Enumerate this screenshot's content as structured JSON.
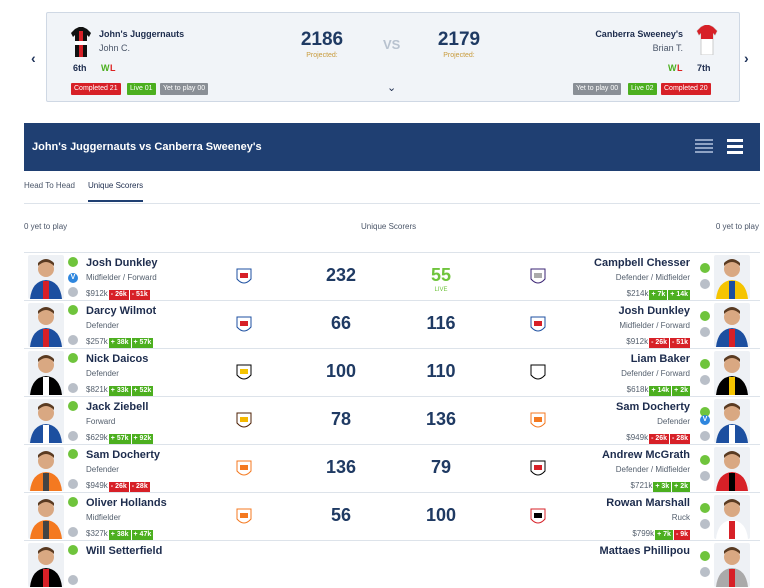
{
  "matchup": {
    "left": {
      "team": "John's Juggernauts",
      "coach": "John C.",
      "rank": "6th",
      "w": "W",
      "l": "L",
      "score": "2186",
      "projected": "Projected:",
      "completed": "Completed 21",
      "live": "Live 01",
      "ytp": "Yet to play 00"
    },
    "right": {
      "team": "Canberra Sweeney's",
      "coach": "Brian T.",
      "rank": "7th",
      "w": "W",
      "l": "L",
      "score": "2179",
      "projected": "Projected:",
      "completed": "Completed 20",
      "live": "Live 02",
      "ytp": "Yet to play 00"
    },
    "vs": "VS"
  },
  "banner": {
    "title": "John's Juggernauts vs Canberra Sweeney's"
  },
  "tabs": [
    "Head To Head",
    "Unique Scorers"
  ],
  "subheader": {
    "left": "0 yet to play",
    "center": "Unique Scorers",
    "right": "0 yet to play"
  },
  "rows": [
    {
      "l": {
        "name": "Josh Dunkley",
        "pos": "Midfielder / Forward",
        "price": "$912k",
        "c1": "- 26k",
        "c2": "- 51k",
        "score": "232",
        "club": "WB"
      },
      "r": {
        "name": "Campbell Chesser",
        "pos": "Defender / Midfielder",
        "price": "$214k",
        "c1": "+ 7k",
        "c2": "+ 14k",
        "score": "55",
        "club": "FRE",
        "live": "LIVE"
      }
    },
    {
      "l": {
        "name": "Darcy Wilmot",
        "pos": "Defender",
        "price": "$257k",
        "c1": "+ 38k",
        "c2": "+ 57k",
        "score": "66",
        "club": "BL"
      },
      "r": {
        "name": "Josh Dunkley",
        "pos": "Midfielder / Forward",
        "price": "$912k",
        "c1": "- 26k",
        "c2": "- 51k",
        "score": "116",
        "club": "WB"
      }
    },
    {
      "l": {
        "name": "Nick Daicos",
        "pos": "Defender",
        "price": "$821k",
        "c1": "+ 33k",
        "c2": "+ 52k",
        "score": "100",
        "club": "RI"
      },
      "r": {
        "name": "Liam Baker",
        "pos": "Defender / Forward",
        "price": "$618k",
        "c1": "+ 14k",
        "c2": "+ 2k",
        "score": "110",
        "club": "CO"
      }
    },
    {
      "l": {
        "name": "Jack Ziebell",
        "pos": "Forward",
        "price": "$629k",
        "c1": "+ 57k",
        "c2": "+ 92k",
        "score": "78",
        "club": "HW"
      },
      "r": {
        "name": "Sam Docherty",
        "pos": "Defender",
        "price": "$949k",
        "c1": "- 26k",
        "c2": "- 28k",
        "score": "136",
        "club": "GWS"
      }
    },
    {
      "l": {
        "name": "Sam Docherty",
        "pos": "Defender",
        "price": "$949k",
        "c1": "- 26k",
        "c2": "- 28k",
        "score": "136",
        "club": "GWS"
      },
      "r": {
        "name": "Andrew McGrath",
        "pos": "Defender / Midfielder",
        "price": "$721k",
        "c1": "+ 3k",
        "c2": "+ 2k",
        "score": "79",
        "club": "STK"
      }
    },
    {
      "l": {
        "name": "Oliver Hollands",
        "pos": "Midfielder",
        "price": "$327k",
        "c1": "+ 38k",
        "c2": "+ 47k",
        "score": "56",
        "club": "GWS"
      },
      "r": {
        "name": "Rowan Marshall",
        "pos": "Ruck",
        "price": "$799k",
        "c1": "+ 7k",
        "c2": "- 9k",
        "score": "100",
        "club": "ES"
      }
    },
    {
      "l": {
        "name": "Will Setterfield",
        "pos": "",
        "price": "",
        "c1": "",
        "c2": "",
        "score": "",
        "club": ""
      },
      "r": {
        "name": "Mattaes Phillipou",
        "pos": "",
        "price": "",
        "c1": "",
        "c2": "",
        "score": "",
        "club": ""
      }
    }
  ],
  "colors": {
    "navy": "#1f3f72",
    "green": "#6fc43c",
    "red": "#d72027"
  }
}
